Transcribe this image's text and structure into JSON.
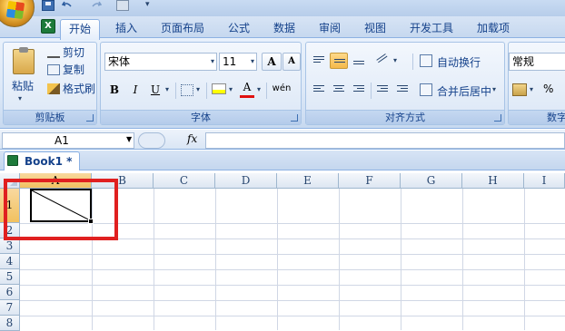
{
  "quick_access": {
    "icons": [
      "office-button",
      "save-icon",
      "undo-icon",
      "redo-icon",
      "print-preview-icon",
      "customize-arrow-icon"
    ]
  },
  "ribbon": {
    "tabs": [
      "开始",
      "插入",
      "页面布局",
      "公式",
      "数据",
      "审阅",
      "视图",
      "开发工具",
      "加载项"
    ],
    "active_tab": "开始",
    "clipboard": {
      "paste": "粘贴",
      "cut": "剪切",
      "copy": "复制",
      "format_painter": "格式刷",
      "label": "剪贴板"
    },
    "font": {
      "font_name": "宋体",
      "font_size": "11",
      "grow": "A",
      "shrink": "A",
      "bold": "B",
      "italic": "I",
      "underline": "U",
      "font_color_glyph": "A",
      "phonetic_glyph": "wén",
      "label": "字体"
    },
    "alignment": {
      "wrap_text": "自动换行",
      "merge_center": "合并后居中",
      "label": "对齐方式"
    },
    "number": {
      "format": "常规",
      "percent": "%",
      "label": "数字"
    }
  },
  "formula_bar": {
    "name_box": "A1",
    "fx": "fx",
    "value": ""
  },
  "workbook": {
    "tab_title": "Book1 *"
  },
  "grid": {
    "columns": [
      "A",
      "B",
      "C",
      "D",
      "E",
      "F",
      "G",
      "H",
      "I"
    ],
    "rows": [
      "1",
      "2",
      "3",
      "4",
      "5",
      "6",
      "7",
      "8"
    ],
    "selected_cell": "A1",
    "annotation_color": "#e02020"
  },
  "colors": {
    "ribbon_text": "#15428b",
    "selected_header": "#f1c15f",
    "active_button": "#f5b94a"
  }
}
